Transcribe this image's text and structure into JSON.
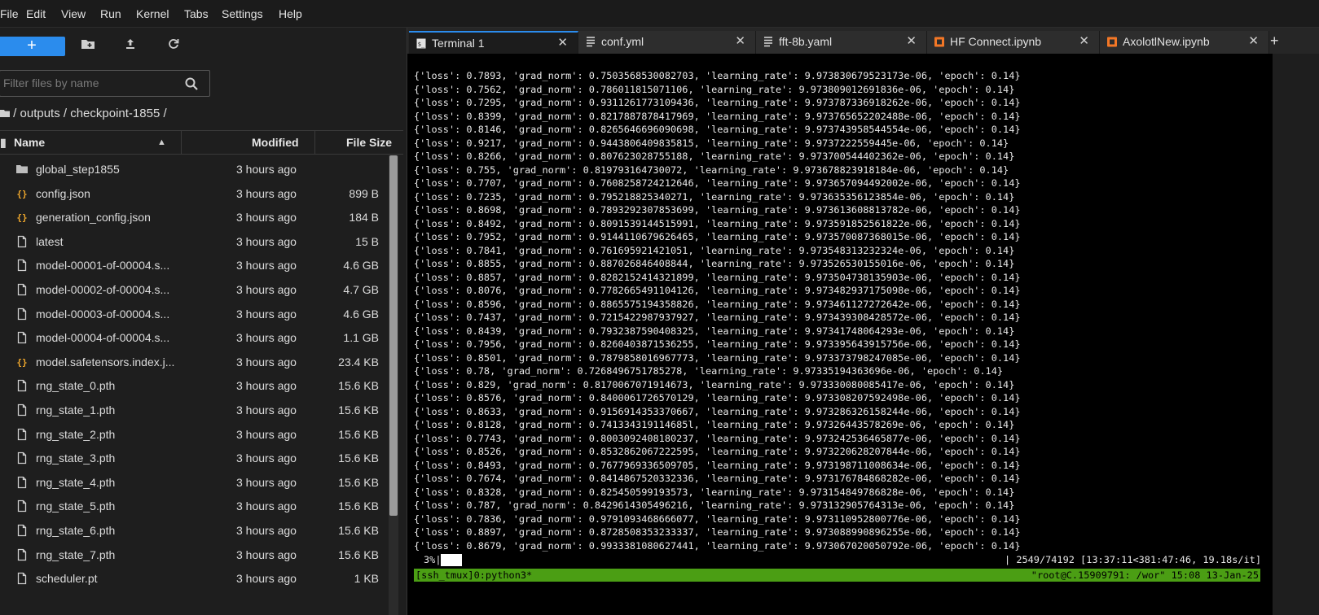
{
  "menu": [
    "File",
    "Edit",
    "View",
    "Run",
    "Kernel",
    "Tabs",
    "Settings",
    "Help"
  ],
  "toolbar": {
    "new_label": "+"
  },
  "filter": {
    "placeholder": "Filter files by name"
  },
  "breadcrumb": "/ outputs / checkpoint-1855 /",
  "columns": {
    "name": "Name",
    "modified": "Modified",
    "size": "File Size"
  },
  "files": [
    {
      "name": "global_step1855",
      "modified": "3 hours ago",
      "size": "",
      "icon": "folder-icon"
    },
    {
      "name": "config.json",
      "modified": "3 hours ago",
      "size": "899 B",
      "icon": "json-icon"
    },
    {
      "name": "generation_config.json",
      "modified": "3 hours ago",
      "size": "184 B",
      "icon": "json-icon"
    },
    {
      "name": "latest",
      "modified": "3 hours ago",
      "size": "15 B",
      "icon": "file-icon"
    },
    {
      "name": "model-00001-of-00004.s...",
      "modified": "3 hours ago",
      "size": "4.6 GB",
      "icon": "file-icon"
    },
    {
      "name": "model-00002-of-00004.s...",
      "modified": "3 hours ago",
      "size": "4.7 GB",
      "icon": "file-icon"
    },
    {
      "name": "model-00003-of-00004.s...",
      "modified": "3 hours ago",
      "size": "4.6 GB",
      "icon": "file-icon"
    },
    {
      "name": "model-00004-of-00004.s...",
      "modified": "3 hours ago",
      "size": "1.1 GB",
      "icon": "file-icon"
    },
    {
      "name": "model.safetensors.index.j...",
      "modified": "3 hours ago",
      "size": "23.4 KB",
      "icon": "json-icon"
    },
    {
      "name": "rng_state_0.pth",
      "modified": "3 hours ago",
      "size": "15.6 KB",
      "icon": "file-icon"
    },
    {
      "name": "rng_state_1.pth",
      "modified": "3 hours ago",
      "size": "15.6 KB",
      "icon": "file-icon"
    },
    {
      "name": "rng_state_2.pth",
      "modified": "3 hours ago",
      "size": "15.6 KB",
      "icon": "file-icon"
    },
    {
      "name": "rng_state_3.pth",
      "modified": "3 hours ago",
      "size": "15.6 KB",
      "icon": "file-icon"
    },
    {
      "name": "rng_state_4.pth",
      "modified": "3 hours ago",
      "size": "15.6 KB",
      "icon": "file-icon"
    },
    {
      "name": "rng_state_5.pth",
      "modified": "3 hours ago",
      "size": "15.6 KB",
      "icon": "file-icon"
    },
    {
      "name": "rng_state_6.pth",
      "modified": "3 hours ago",
      "size": "15.6 KB",
      "icon": "file-icon"
    },
    {
      "name": "rng_state_7.pth",
      "modified": "3 hours ago",
      "size": "15.6 KB",
      "icon": "file-icon"
    },
    {
      "name": "scheduler.pt",
      "modified": "3 hours ago",
      "size": "1 KB",
      "icon": "file-icon"
    }
  ],
  "tabs": [
    {
      "label": "Terminal 1",
      "icon": "terminal-icon",
      "active": true
    },
    {
      "label": "conf.yml",
      "icon": "text-file-icon",
      "active": false
    },
    {
      "label": "fft-8b.yaml",
      "icon": "text-file-icon",
      "active": false
    },
    {
      "label": "HF Connect.ipynb",
      "icon": "notebook-icon",
      "active": false
    },
    {
      "label": "AxolotlNew.ipynb",
      "icon": "notebook-icon",
      "active": false
    }
  ],
  "terminal": {
    "lines": [
      "{'loss': 0.7893, 'grad_norm': 0.7503568530082703, 'learning_rate': 9.973830679523173e-06, 'epoch': 0.14}",
      "{'loss': 0.7562, 'grad_norm': 0.786011815071106, 'learning_rate': 9.973809012691836e-06, 'epoch': 0.14}",
      "{'loss': 0.7295, 'grad_norm': 0.9311261773109436, 'learning_rate': 9.973787336918262e-06, 'epoch': 0.14}",
      "{'loss': 0.8399, 'grad_norm': 0.8217887878417969, 'learning_rate': 9.973765652202488e-06, 'epoch': 0.14}",
      "{'loss': 0.8146, 'grad_norm': 0.8265646696090698, 'learning_rate': 9.973743958544554e-06, 'epoch': 0.14}",
      "{'loss': 0.9217, 'grad_norm': 0.9443806409835815, 'learning_rate': 9.9737222559445e-06, 'epoch': 0.14}",
      "{'loss': 0.8266, 'grad_norm': 0.807623028755188, 'learning_rate': 9.973700544402362e-06, 'epoch': 0.14}",
      "{'loss': 0.755, 'grad_norm': 0.819793164730072, 'learning_rate': 9.973678823918184e-06, 'epoch': 0.14}",
      "{'loss': 0.7707, 'grad_norm': 0.7608258724212646, 'learning_rate': 9.973657094492002e-06, 'epoch': 0.14}",
      "{'loss': 0.7235, 'grad_norm': 0.795218825340271, 'learning_rate': 9.973635356123854e-06, 'epoch': 0.14}",
      "{'loss': 0.8698, 'grad_norm': 0.7893292307853699, 'learning_rate': 9.973613608813782e-06, 'epoch': 0.14}",
      "{'loss': 0.8492, 'grad_norm': 0.8091539144515991, 'learning_rate': 9.973591852561822e-06, 'epoch': 0.14}",
      "{'loss': 0.7952, 'grad_norm': 0.9144110679626465, 'learning_rate': 9.973570087368015e-06, 'epoch': 0.14}",
      "{'loss': 0.7841, 'grad_norm': 0.761695921421051, 'learning_rate': 9.973548313232324e-06, 'epoch': 0.14}",
      "{'loss': 0.8855, 'grad_norm': 0.887026846408844, 'learning_rate': 9.973526530155016e-06, 'epoch': 0.14}",
      "{'loss': 0.8857, 'grad_norm': 0.8282152414321899, 'learning_rate': 9.973504738135903e-06, 'epoch': 0.14}",
      "{'loss': 0.8076, 'grad_norm': 0.7782665491104126, 'learning_rate': 9.973482937175098e-06, 'epoch': 0.14}",
      "{'loss': 0.8596, 'grad_norm': 0.8865575194358826, 'learning_rate': 9.973461127272642e-06, 'epoch': 0.14}",
      "{'loss': 0.7437, 'grad_norm': 0.7215422987937927, 'learning_rate': 9.973439308428572e-06, 'epoch': 0.14}",
      "{'loss': 0.8439, 'grad_norm': 0.7932387590408325, 'learning_rate': 9.97341748064293e-06, 'epoch': 0.14}",
      "{'loss': 0.7956, 'grad_norm': 0.8260403871536255, 'learning_rate': 9.973395643915756e-06, 'epoch': 0.14}",
      "{'loss': 0.8501, 'grad_norm': 0.7879858016967773, 'learning_rate': 9.973373798247085e-06, 'epoch': 0.14}",
      "{'loss': 0.78, 'grad_norm': 0.7268496751785278, 'learning_rate': 9.97335194363696e-06, 'epoch': 0.14}",
      "{'loss': 0.829, 'grad_norm': 0.8170067071914673, 'learning_rate': 9.973330080085417e-06, 'epoch': 0.14}",
      "{'loss': 0.8576, 'grad_norm': 0.8400061726570129, 'learning_rate': 9.973308207592498e-06, 'epoch': 0.14}",
      "{'loss': 0.8633, 'grad_norm': 0.9156914353370667, 'learning_rate': 9.973286326158244e-06, 'epoch': 0.14}",
      "{'loss': 0.8128, 'grad_norm': 0.741334319114685l, 'learning_rate': 9.97326443578269e-06, 'epoch': 0.14}",
      "{'loss': 0.7743, 'grad_norm': 0.8003092408180237, 'learning_rate': 9.973242536465877e-06, 'epoch': 0.14}",
      "{'loss': 0.8526, 'grad_norm': 0.8532862067222595, 'learning_rate': 9.973220628207844e-06, 'epoch': 0.14}",
      "{'loss': 0.8493, 'grad_norm': 0.7677969336509705, 'learning_rate': 9.973198711008634e-06, 'epoch': 0.14}",
      "{'loss': 0.7674, 'grad_norm': 0.8414867520332336, 'learning_rate': 9.973176784868282e-06, 'epoch': 0.14}",
      "{'loss': 0.8328, 'grad_norm': 0.825450599193573, 'learning_rate': 9.973154849786828e-06, 'epoch': 0.14}",
      "{'loss': 0.787, 'grad_norm': 0.8429614305496216, 'learning_rate': 9.973132905764313e-06, 'epoch': 0.14}",
      "{'loss': 0.7836, 'grad_norm': 0.9791093468666077, 'learning_rate': 9.973110952800776e-06, 'epoch': 0.14}",
      "{'loss': 0.8897, 'grad_norm': 0.8728508353233337, 'learning_rate': 9.973088990896255e-06, 'epoch': 0.14}",
      "{'loss': 0.8679, 'grad_norm': 0.9933381080627441, 'learning_rate': 9.973067020050792e-06, 'epoch': 0.14}"
    ],
    "progress_pct": "3%|",
    "progress_fraction": 0.034,
    "progress_right": "| 2549/74192 [13:37:11<381:47:46, 19.18s/it]",
    "status_left": "[ssh_tmux]0:python3*",
    "status_right": "\"root@C.15909791: /wor\" 15:08 13-Jan-25"
  }
}
